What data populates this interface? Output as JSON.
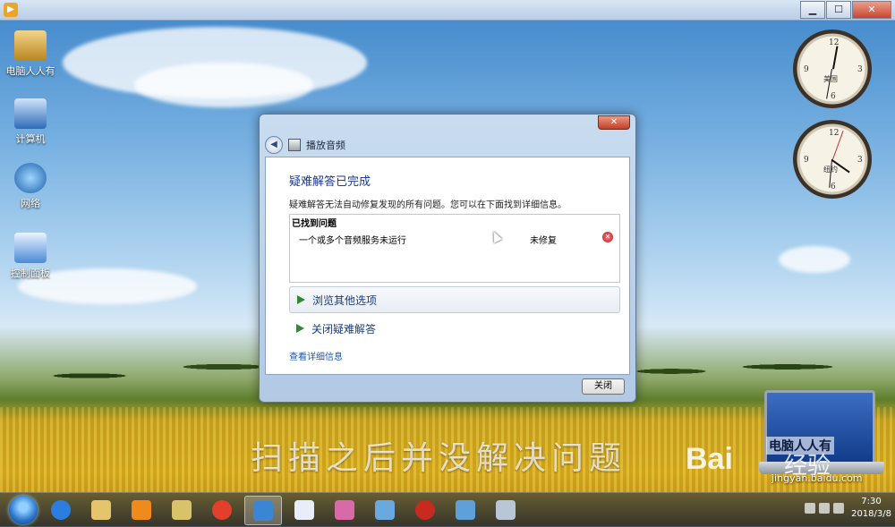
{
  "window": {
    "title": "",
    "buttons": {
      "minimize": "▁",
      "maximize": "☐",
      "close": "✕"
    }
  },
  "desktop_icons": [
    {
      "label": "电脑人人有",
      "icon": "user-folder-icon"
    },
    {
      "label": "计算机",
      "icon": "computer-icon"
    },
    {
      "label": "网络",
      "icon": "network-icon"
    },
    {
      "label": "控制面板",
      "icon": "control-panel-icon"
    }
  ],
  "gadget_clocks": [
    {
      "label": "美国"
    },
    {
      "label": "纽约"
    }
  ],
  "dialog": {
    "title": "播放音频",
    "close_symbol": "✕",
    "heading": "疑难解答已完成",
    "description": "疑难解答无法自动修复发现的所有问题。您可以在下面找到详细信息。",
    "problems_header": "已找到问题",
    "problem": {
      "text": "一个或多个音频服务未运行",
      "status": "未修复",
      "status_icon": "error-x-icon"
    },
    "options": {
      "browse": "浏览其他选项",
      "close_troubleshooting": "关闭疑难解答"
    },
    "details_link": "查看详细信息",
    "close_button": "关闭"
  },
  "overlay": {
    "caption": "扫描之后并没解决问题",
    "laptop_label": "电脑人人有",
    "watermark_brand": "Bai",
    "watermark_jingyan": "经验",
    "watermark_url": "jingyan.baidu.com"
  },
  "taskbar": {
    "items": [
      "ie-icon",
      "folder-icon",
      "media-player-icon",
      "jade-folder-icon",
      "chrome-icon",
      "troubleshoot-icon",
      "file-icon",
      "paint-icon",
      "remote-icon",
      "chinese-chess-icon",
      "system-repair-icon",
      "app-window-icon"
    ],
    "active_index": 5,
    "time": "7:30",
    "date": "2018/3/8"
  }
}
